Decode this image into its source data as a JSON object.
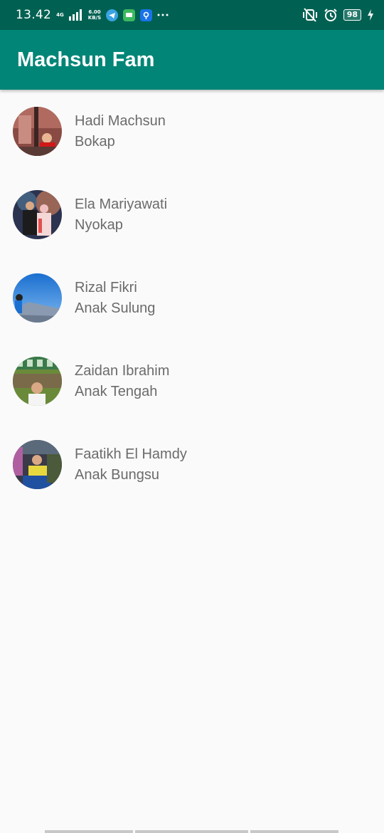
{
  "status_bar": {
    "time": "13.42",
    "network": "4G",
    "speed_value": "6.00",
    "speed_unit": "KB/S",
    "battery": "98"
  },
  "app_bar": {
    "title": "Machsun Fam"
  },
  "members": [
    {
      "name": "Hadi Machsun",
      "role": "Bokap"
    },
    {
      "name": "Ela Mariyawati",
      "role": "Nyokap"
    },
    {
      "name": "Rizal Fikri",
      "role": "Anak Sulung"
    },
    {
      "name": "Zaidan Ibrahim",
      "role": "Anak Tengah"
    },
    {
      "name": "Faatikh El Hamdy",
      "role": "Anak Bungsu"
    }
  ],
  "colors": {
    "status_bar": "#006152",
    "primary": "#008577",
    "text_secondary": "#6b6b6b",
    "background": "#fafafa"
  }
}
